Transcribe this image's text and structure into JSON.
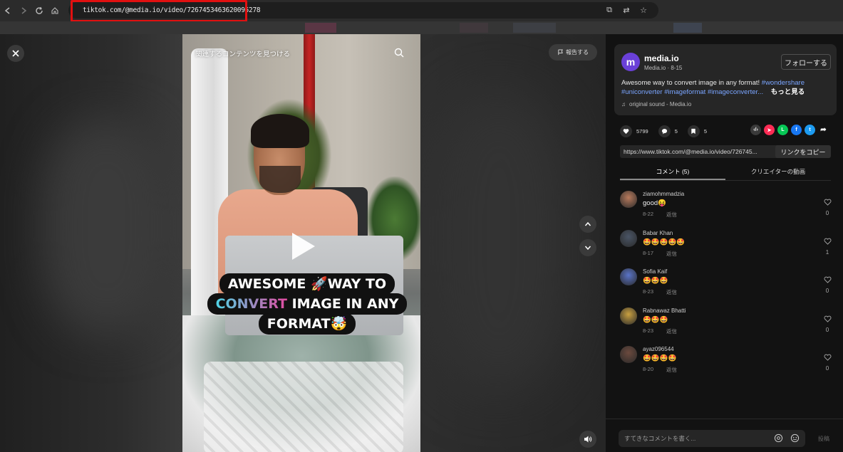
{
  "browser": {
    "url": "tiktok.com/@media.io/video/7267453463620095278",
    "icons": [
      "back-icon",
      "forward-icon",
      "reload-icon",
      "home-icon",
      "cast-icon",
      "translate-icon",
      "star-icon"
    ]
  },
  "video": {
    "related_search": "関連するコンテンツを見つける",
    "report_label": "報告する",
    "caption_line1": "AWESOME 🚀WAY TO",
    "caption_line2_a": "CONVERT",
    "caption_line2_b": " IMAGE IN ANY",
    "caption_line3": "FORMAT🤯"
  },
  "author": {
    "avatar_letter": "m",
    "name": "media.io",
    "sub": "Media.io · 8-15",
    "follow_label": "フォローする",
    "description": "Awesome way to convert image in any format!",
    "hashtags": [
      "#wondershare",
      "#uniconverter",
      "#imageformat",
      "#imageconverter..."
    ],
    "more_label": "もっと見る",
    "sound": "original sound - Media.io"
  },
  "stats": {
    "likes": "5799",
    "comments": "5",
    "saves": "5"
  },
  "share": {
    "link": "https://www.tiktok.com/@media.io/video/726745...",
    "copy_label": "リンクをコピー"
  },
  "tabs": {
    "comments": "コメント (5)",
    "creator_videos": "クリエイターの動画"
  },
  "comments": [
    {
      "user": "ziamohmmadzia",
      "text": "good😝",
      "date": "8-22",
      "reply": "返信",
      "likes": "0",
      "avatar_color": "#b87a5c"
    },
    {
      "user": "Babar Khan",
      "text": "🤩🤩🤩🤩🤩",
      "date": "8-17",
      "reply": "返信",
      "likes": "1",
      "avatar_color": "#4a5566"
    },
    {
      "user": "Sofia Kaif",
      "text": "🤩🤩🤩",
      "date": "8-23",
      "reply": "返信",
      "likes": "0",
      "avatar_color": "#5a74c8"
    },
    {
      "user": "Rabnawaz Bhatti",
      "text": "🤩🤩🤩",
      "date": "8-23",
      "reply": "返信",
      "likes": "0",
      "avatar_color": "#c9a040"
    },
    {
      "user": "ayaz096544",
      "text": "🤩🤩🤩🤩",
      "date": "8-20",
      "reply": "返信",
      "likes": "0",
      "avatar_color": "#6c4a3e"
    }
  ],
  "compose": {
    "placeholder": "すてきなコメントを書く...",
    "post_label": "投稿"
  },
  "colors": {
    "accent_link": "#7aa5ff",
    "highlight_box": "#e01010",
    "avatar_brand": "#6a40d8"
  }
}
